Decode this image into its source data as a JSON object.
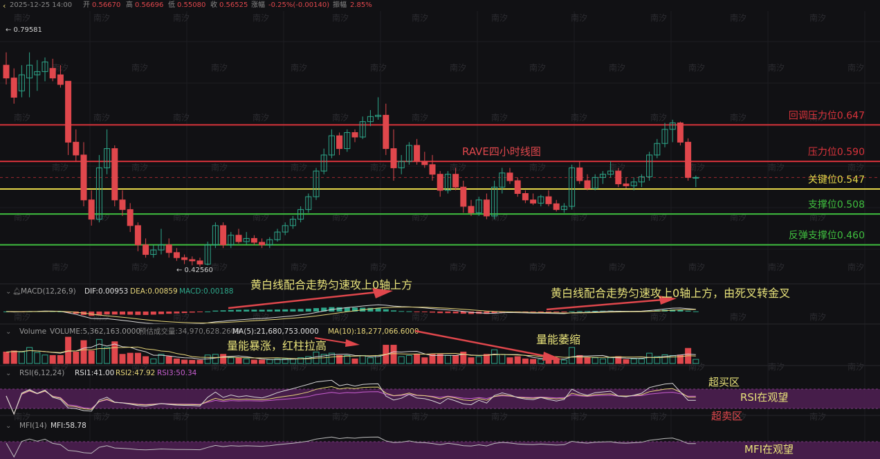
{
  "header": {
    "datetime": "2025-12-25 14:00",
    "open_label": "开",
    "open": "0.56670",
    "high_label": "高",
    "high": "0.56696",
    "low_label": "低",
    "low": "0.55080",
    "close_label": "收",
    "close": "0.56525",
    "change_label": "涨幅",
    "change": "-0.25%(-0.00140)",
    "amplitude_label": "振幅",
    "amplitude": "2.85%"
  },
  "title": "RAVE四小时线图",
  "watermark": "南汐",
  "price_extremes": {
    "high_label": "← 0.79581",
    "low_label": "← 0.42560"
  },
  "levels": [
    {
      "label": "回调压力位0.647",
      "value": 0.647,
      "color": "#d9333b"
    },
    {
      "label": "压力位0.590",
      "value": 0.59,
      "color": "#d9333b"
    },
    {
      "label": "关键位0.547",
      "value": 0.547,
      "color": "#e6d84a"
    },
    {
      "label": "支撑位0.508",
      "value": 0.508,
      "color": "#3fbf3f"
    },
    {
      "label": "反弹支撑位0.460",
      "value": 0.46,
      "color": "#3fbf3f"
    }
  ],
  "dashed_level": 0.565,
  "macd": {
    "name": "MACD(12,26,9)",
    "dif": "DIF:0.00953",
    "dea": "DEA:0.00859",
    "macd": "MACD:0.00188"
  },
  "volume": {
    "name": "Volume",
    "volume": "VOLUME:5,362,163.0000",
    "est": "预估成交量:34,970,628.2609",
    "ma5": "MA(5):21,680,753.0000",
    "ma10": "MA(10):18,277,066.6000"
  },
  "rsi": {
    "name": "RSI(6,12,24)",
    "rsi1": "RSI1:41.00",
    "rsi2": "RSI2:47.92",
    "rsi3": "RSI3:50.34"
  },
  "mfi": {
    "name": "MFI(14)",
    "mfi": "MFI:58.78"
  },
  "annotations": {
    "macd_1": "黄白线配合走势匀速攻上0轴上方",
    "macd_2": "黄白线配合走势匀速攻上0轴上方，由死叉转金叉",
    "vol_1": "量能暴涨，红柱拉高",
    "vol_2": "量能萎缩",
    "rsi_overbought": "超买区",
    "rsi_watch": "RSI在观望",
    "rsi_oversold": "超卖区",
    "mfi_watch": "MFI在观望"
  },
  "colors": {
    "up": "#2ea88b",
    "down": "#e0474c",
    "annotation": "#e8e27a",
    "rsi_band": "#4a1f4d"
  },
  "chart_data": {
    "type": "candlestick",
    "title": "RAVE四小时线图",
    "ylim": [
      0.41,
      0.82
    ],
    "candles": [
      [
        0.74,
        0.76,
        0.71,
        0.72
      ],
      [
        0.72,
        0.735,
        0.68,
        0.69
      ],
      [
        0.7,
        0.74,
        0.69,
        0.725
      ],
      [
        0.72,
        0.76,
        0.69,
        0.74
      ],
      [
        0.725,
        0.748,
        0.7,
        0.73
      ],
      [
        0.73,
        0.752,
        0.715,
        0.745
      ],
      [
        0.735,
        0.75,
        0.715,
        0.72
      ],
      [
        0.725,
        0.74,
        0.705,
        0.71
      ],
      [
        0.715,
        0.715,
        0.6,
        0.62
      ],
      [
        0.62,
        0.64,
        0.59,
        0.6
      ],
      [
        0.6,
        0.62,
        0.52,
        0.53
      ],
      [
        0.53,
        0.545,
        0.49,
        0.5
      ],
      [
        0.5,
        0.6,
        0.495,
        0.58
      ],
      [
        0.58,
        0.64,
        0.57,
        0.61
      ],
      [
        0.61,
        0.615,
        0.52,
        0.53
      ],
      [
        0.53,
        0.545,
        0.505,
        0.515
      ],
      [
        0.515,
        0.525,
        0.48,
        0.49
      ],
      [
        0.49,
        0.495,
        0.45,
        0.46
      ],
      [
        0.46,
        0.47,
        0.44,
        0.445
      ],
      [
        0.445,
        0.46,
        0.44,
        0.452
      ],
      [
        0.452,
        0.485,
        0.445,
        0.46
      ],
      [
        0.46,
        0.47,
        0.44,
        0.448
      ],
      [
        0.448,
        0.455,
        0.435,
        0.44
      ],
      [
        0.44,
        0.445,
        0.43,
        0.437
      ],
      [
        0.437,
        0.442,
        0.428,
        0.435
      ],
      [
        0.435,
        0.44,
        0.426,
        0.43
      ],
      [
        0.43,
        0.465,
        0.428,
        0.46
      ],
      [
        0.46,
        0.495,
        0.455,
        0.49
      ],
      [
        0.49,
        0.495,
        0.455,
        0.46
      ],
      [
        0.46,
        0.48,
        0.455,
        0.475
      ],
      [
        0.475,
        0.485,
        0.462,
        0.465
      ],
      [
        0.465,
        0.48,
        0.46,
        0.47
      ],
      [
        0.47,
        0.475,
        0.46,
        0.464
      ],
      [
        0.464,
        0.47,
        0.455,
        0.46
      ],
      [
        0.46,
        0.472,
        0.455,
        0.468
      ],
      [
        0.468,
        0.485,
        0.465,
        0.48
      ],
      [
        0.48,
        0.495,
        0.475,
        0.49
      ],
      [
        0.49,
        0.505,
        0.485,
        0.5
      ],
      [
        0.5,
        0.52,
        0.495,
        0.515
      ],
      [
        0.515,
        0.54,
        0.51,
        0.535
      ],
      [
        0.535,
        0.58,
        0.53,
        0.575
      ],
      [
        0.575,
        0.61,
        0.57,
        0.6
      ],
      [
        0.6,
        0.64,
        0.595,
        0.63
      ],
      [
        0.63,
        0.635,
        0.6,
        0.61
      ],
      [
        0.61,
        0.64,
        0.605,
        0.635
      ],
      [
        0.635,
        0.64,
        0.62,
        0.628
      ],
      [
        0.628,
        0.66,
        0.625,
        0.652
      ],
      [
        0.652,
        0.67,
        0.645,
        0.66
      ],
      [
        0.66,
        0.69,
        0.655,
        0.662
      ],
      [
        0.662,
        0.68,
        0.6,
        0.61
      ],
      [
        0.61,
        0.64,
        0.56,
        0.58
      ],
      [
        0.58,
        0.6,
        0.57,
        0.59
      ],
      [
        0.59,
        0.62,
        0.585,
        0.615
      ],
      [
        0.615,
        0.625,
        0.585,
        0.59
      ],
      [
        0.59,
        0.605,
        0.58,
        0.585
      ],
      [
        0.585,
        0.6,
        0.56,
        0.57
      ],
      [
        0.57,
        0.575,
        0.535,
        0.545
      ],
      [
        0.545,
        0.575,
        0.54,
        0.57
      ],
      [
        0.57,
        0.58,
        0.545,
        0.55
      ],
      [
        0.55,
        0.56,
        0.51,
        0.52
      ],
      [
        0.52,
        0.53,
        0.505,
        0.51
      ],
      [
        0.51,
        0.535,
        0.505,
        0.53
      ],
      [
        0.53,
        0.54,
        0.5,
        0.505
      ],
      [
        0.505,
        0.56,
        0.5,
        0.55
      ],
      [
        0.55,
        0.58,
        0.54,
        0.572
      ],
      [
        0.572,
        0.58,
        0.555,
        0.56
      ],
      [
        0.56,
        0.565,
        0.535,
        0.54
      ],
      [
        0.54,
        0.545,
        0.525,
        0.53
      ],
      [
        0.53,
        0.54,
        0.522,
        0.525
      ],
      [
        0.525,
        0.538,
        0.52,
        0.535
      ],
      [
        0.535,
        0.545,
        0.52,
        0.524
      ],
      [
        0.524,
        0.53,
        0.512,
        0.515
      ],
      [
        0.515,
        0.525,
        0.51,
        0.52
      ],
      [
        0.52,
        0.585,
        0.515,
        0.58
      ],
      [
        0.58,
        0.59,
        0.555,
        0.56
      ],
      [
        0.56,
        0.57,
        0.545,
        0.548
      ],
      [
        0.548,
        0.57,
        0.545,
        0.565
      ],
      [
        0.565,
        0.575,
        0.555,
        0.57
      ],
      [
        0.57,
        0.59,
        0.565,
        0.575
      ],
      [
        0.575,
        0.58,
        0.55,
        0.555
      ],
      [
        0.555,
        0.565,
        0.548,
        0.552
      ],
      [
        0.552,
        0.565,
        0.545,
        0.558
      ],
      [
        0.558,
        0.57,
        0.55,
        0.566
      ],
      [
        0.566,
        0.605,
        0.56,
        0.6
      ],
      [
        0.6,
        0.625,
        0.595,
        0.618
      ],
      [
        0.618,
        0.65,
        0.612,
        0.64
      ],
      [
        0.64,
        0.655,
        0.62,
        0.65
      ],
      [
        0.65,
        0.652,
        0.615,
        0.62
      ],
      [
        0.62,
        0.626,
        0.56,
        0.565
      ],
      [
        0.565,
        0.568,
        0.55,
        0.565
      ]
    ]
  }
}
